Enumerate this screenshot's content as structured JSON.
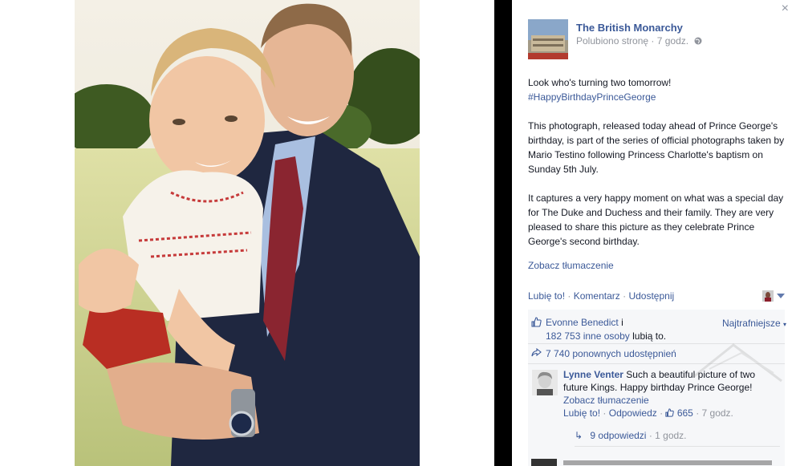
{
  "page": {
    "name": "The British Monarchy",
    "meta": "Polubiono stronę · 7 godz.",
    "globe_icon": "globe-icon"
  },
  "post": {
    "line1": "Look who's turning two tomorrow!",
    "hashtag": "#HappyBirthdayPrinceGeorge",
    "para2": "This photograph, released today ahead of Prince George's birthday, is part of the series of official photographs taken by Mario Testino following Princess Charlotte's baptism on Sunday 5th July.",
    "para3": "It captures a very happy moment on what was a special day for The Duke and Duchess and their family. They are very pleased to share this picture as they celebrate Prince George's second birthday.",
    "translate": "Zobacz tłumaczenie"
  },
  "actions": {
    "like": "Lubię to!",
    "comment": "Komentarz",
    "share": "Udostępnij",
    "dot": "·"
  },
  "likes": {
    "first_name": "Evonne Benedict",
    "conj": "i",
    "others": "182 753 inne osoby",
    "suffix": "lubią to.",
    "sort": "Najtrafniejsze"
  },
  "shares": {
    "text": "7 740 ponownych udostępnień"
  },
  "comment": {
    "author": "Lynne Venter",
    "text": "Such a beautiful picture of two future Kings. Happy birthday Prince George!",
    "translate": "Zobacz tłumaczenie",
    "like": "Lubię to!",
    "reply": "Odpowiedz",
    "like_count": "665",
    "time": "7 godz.",
    "replies": "9 odpowiedzi",
    "replies_time": "1 godz."
  },
  "colors": {
    "link": "#3b5998",
    "ufi_bg": "#f6f7f9",
    "meta": "#90949c"
  }
}
